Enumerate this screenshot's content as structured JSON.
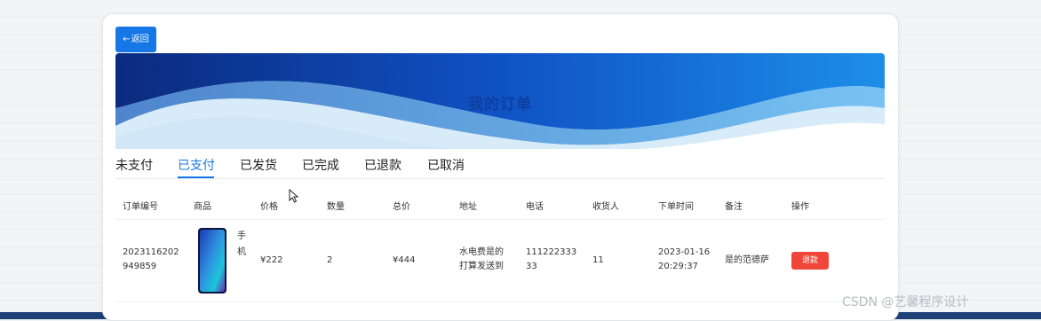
{
  "back_button": {
    "label": "返回",
    "icon": "arrow-left-icon"
  },
  "banner": {
    "title": "我的订单"
  },
  "tabs": [
    {
      "label": "未支付",
      "active": false
    },
    {
      "label": "已支付",
      "active": true
    },
    {
      "label": "已发货",
      "active": false
    },
    {
      "label": "已完成",
      "active": false
    },
    {
      "label": "已退款",
      "active": false
    },
    {
      "label": "已取消",
      "active": false
    }
  ],
  "table": {
    "headers": [
      "订单编号",
      "商品",
      "价格",
      "数量",
      "总价",
      "地址",
      "电话",
      "收货人",
      "下单时间",
      "备注",
      "操作"
    ],
    "rows": [
      {
        "order_no_line1": "2023116202",
        "order_no_line2": "949859",
        "product_name_line1": "手",
        "product_name_line2": "机",
        "price": "¥222",
        "quantity": "2",
        "total": "¥444",
        "address_line1": "水电费是的",
        "address_line2": "打算发送到",
        "phone_line1": "111222333",
        "phone_line2": "33",
        "receiver": "11",
        "time_line1": "2023-01-16",
        "time_line2": "20:29:37",
        "remark": "是的范德萨",
        "action": "退款"
      }
    ]
  },
  "watermark": "CSDN @艺馨程序设计",
  "colors": {
    "accent": "#1677e6",
    "refund": "#f0463a",
    "banner_dark": "#0b2f8a"
  }
}
